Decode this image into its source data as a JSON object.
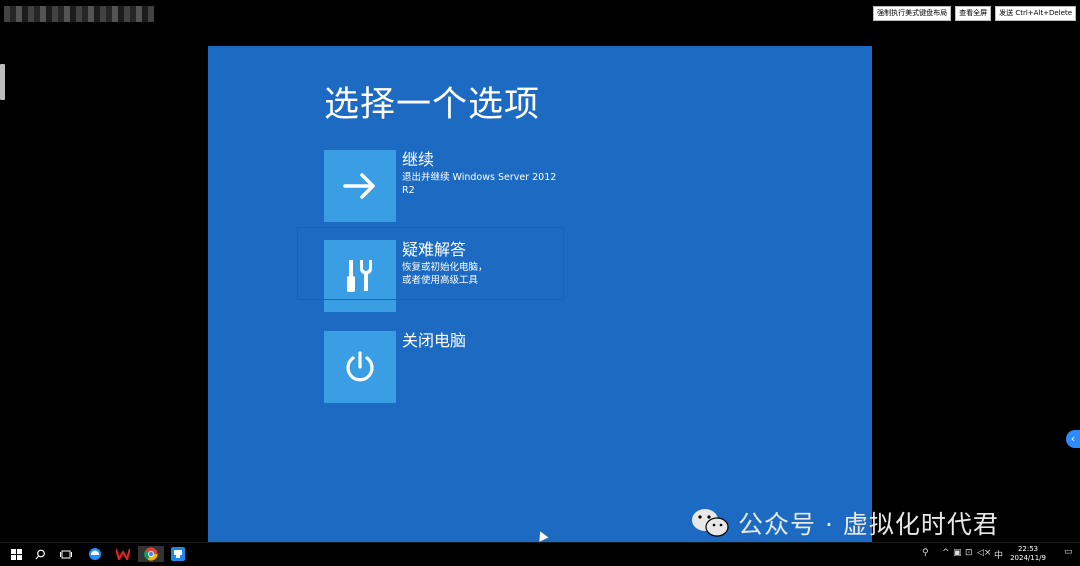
{
  "toolbar": {
    "force_keyboard_label": "强制执行美式键盘布局",
    "fullscreen_label": "查看全屏",
    "send_cad_label": "发送 Ctrl+Alt+Delete"
  },
  "boot_menu": {
    "heading": "选择一个选项",
    "options": [
      {
        "title": "继续",
        "desc_line1": "退出并继续 Windows Server 2012",
        "desc_line2": "R2",
        "icon": "arrow-right-icon"
      },
      {
        "title": "疑难解答",
        "desc_line1": "恢复或初始化电脑，",
        "desc_line2": "或者使用高级工具",
        "icon": "tools-icon"
      },
      {
        "title": "关闭电脑",
        "desc_line1": "",
        "desc_line2": "",
        "icon": "power-icon"
      }
    ],
    "tile_color": "#3a9ee4",
    "background_color": "#1c6ac1",
    "highlight_color": "#c8232c"
  },
  "watermark": {
    "text": "公众号 · 虚拟化时代君",
    "icon": "wechat-icon"
  },
  "taskbar": {
    "icons": [
      "windows-start-icon",
      "search-icon",
      "task-view-icon",
      "edge-icon",
      "wps-icon",
      "chrome-icon",
      "app-icon"
    ],
    "tray": {
      "ime": "中",
      "time": "22:53",
      "date": "2024/11/9"
    }
  }
}
